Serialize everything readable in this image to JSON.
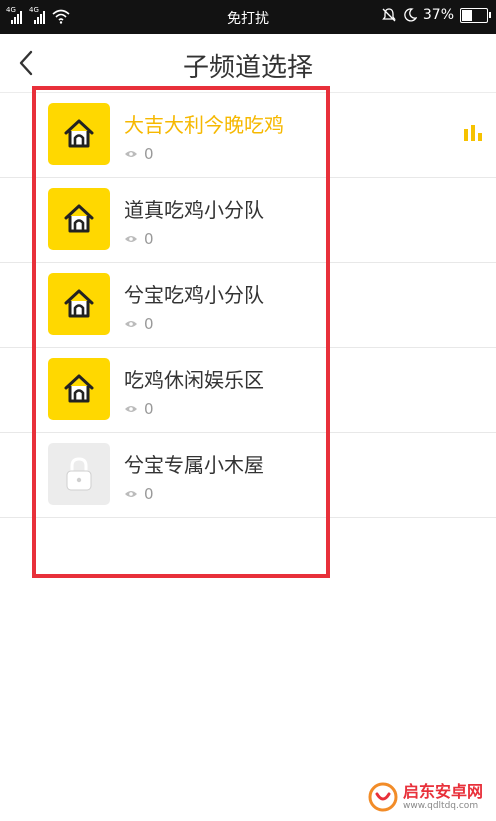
{
  "status_bar": {
    "signal_1_label": "4G",
    "signal_2_label": "4G",
    "carrier_text": "免打扰",
    "battery_percent": "37%",
    "battery_level": 0.37
  },
  "header": {
    "title": "子频道选择",
    "back_icon": "chevron-left-icon"
  },
  "channels": [
    {
      "name": "大吉大利今晚吃鸡",
      "views": "0",
      "icon": "house-icon",
      "locked": false,
      "active": true
    },
    {
      "name": "道真吃鸡小分队",
      "views": "0",
      "icon": "house-icon",
      "locked": false,
      "active": false
    },
    {
      "name": "兮宝吃鸡小分队",
      "views": "0",
      "icon": "house-icon",
      "locked": false,
      "active": false
    },
    {
      "name": "吃鸡休闲娱乐区",
      "views": "0",
      "icon": "house-icon",
      "locked": false,
      "active": false
    },
    {
      "name": "兮宝专属小木屋",
      "views": "0",
      "icon": "lock-icon",
      "locked": true,
      "active": false
    }
  ],
  "colors": {
    "accent": "#f6b800",
    "thumb_gold": "#ffd800",
    "annotation_red": "#e8303a"
  },
  "watermark": {
    "brand": "启东安卓网",
    "url": "www.qdltdq.com"
  }
}
